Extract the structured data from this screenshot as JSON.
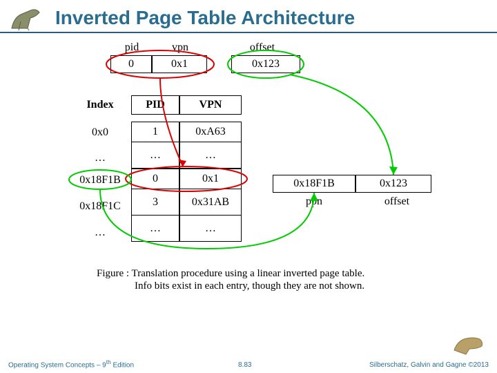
{
  "title": "Inverted Page Table Architecture",
  "virtual_address": {
    "labels": {
      "pid": "pid",
      "vpn": "vpn",
      "offset": "offset"
    },
    "values": {
      "pid": "0",
      "vpn": "0x1",
      "offset": "0x123"
    }
  },
  "table": {
    "headers": {
      "index": "Index",
      "pid": "PID",
      "vpn": "VPN"
    },
    "rows": [
      {
        "index": "0x0",
        "pid": "1",
        "vpn": "0xA63"
      },
      {
        "index": "…",
        "pid": "…",
        "vpn": "…"
      },
      {
        "index": "0x18F1B",
        "pid": "0",
        "vpn": "0x1"
      },
      {
        "index": "0x18F1C",
        "pid": "3",
        "vpn": "0x31AB"
      },
      {
        "index": "…",
        "pid": "…",
        "vpn": "…"
      }
    ]
  },
  "physical_address": {
    "labels": {
      "ppn": "ppn",
      "offset": "offset"
    },
    "values": {
      "ppn": "0x18F1B",
      "offset": "0x123"
    }
  },
  "caption_line1": "Figure : Translation procedure using a linear inverted page table.",
  "caption_line2": "Info bits exist in each entry, though they are not shown.",
  "footer": {
    "left_a": "Operating System Concepts – 9",
    "left_sup": "th",
    "left_b": " Edition",
    "mid": "8.83",
    "right": "Silberschatz, Galvin and Gagne ©2013"
  }
}
